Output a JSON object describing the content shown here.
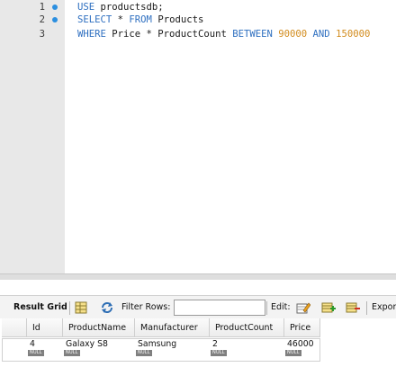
{
  "editor": {
    "lines": [
      {
        "number": "1",
        "tokens": [
          {
            "t": "USE",
            "c": "kw"
          },
          {
            "t": " productsdb;",
            "c": "id"
          }
        ]
      },
      {
        "number": "2",
        "tokens": [
          {
            "t": "SELECT",
            "c": "kw"
          },
          {
            "t": " * ",
            "c": "id"
          },
          {
            "t": "FROM",
            "c": "kw"
          },
          {
            "t": " Products",
            "c": "id"
          }
        ]
      },
      {
        "number": "3",
        "tokens": [
          {
            "t": "WHERE",
            "c": "kw"
          },
          {
            "t": " Price * ProductCount ",
            "c": "id"
          },
          {
            "t": "BETWEEN",
            "c": "kw"
          },
          {
            "t": " ",
            "c": "id"
          },
          {
            "t": "90000",
            "c": "num"
          },
          {
            "t": " ",
            "c": "id"
          },
          {
            "t": "AND",
            "c": "kw"
          },
          {
            "t": " ",
            "c": "id"
          },
          {
            "t": "150000",
            "c": "num"
          }
        ]
      }
    ]
  },
  "toolbar": {
    "result_grid_label": "Result Grid",
    "filter_rows_label": "Filter Rows:",
    "filter_value": "",
    "edit_label": "Edit:",
    "export_label": "Expor"
  },
  "grid": {
    "columns": [
      "Id",
      "ProductName",
      "Manufacturer",
      "ProductCount",
      "Price"
    ],
    "rows": [
      [
        "4",
        "Galaxy S8",
        "Samsung",
        "2",
        "46000"
      ]
    ],
    "null_label": "NULL"
  },
  "colors": {
    "keyword": "#2e6fc0",
    "number": "#d28c1e",
    "gutter": "#e8e8e8",
    "line_marker": "#2b8fe0"
  }
}
